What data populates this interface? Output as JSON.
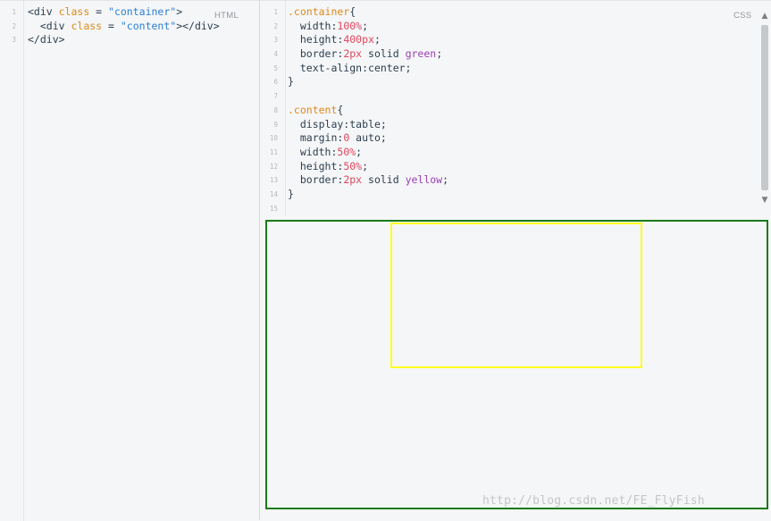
{
  "html_panel": {
    "label": "HTML",
    "lines": [
      {
        "n": "1",
        "tokens": [
          {
            "t": "<div ",
            "c": "tag"
          },
          {
            "t": "class",
            "c": "attr"
          },
          {
            "t": " = ",
            "c": "plain"
          },
          {
            "t": "\"container\"",
            "c": "str"
          },
          {
            "t": ">",
            "c": "tag"
          }
        ]
      },
      {
        "n": "2",
        "tokens": [
          {
            "t": "  <div ",
            "c": "tag"
          },
          {
            "t": "class",
            "c": "attr"
          },
          {
            "t": " = ",
            "c": "plain"
          },
          {
            "t": "\"content\"",
            "c": "str"
          },
          {
            "t": "></div>",
            "c": "tag"
          }
        ]
      },
      {
        "n": "3",
        "tokens": [
          {
            "t": "</div>",
            "c": "tag"
          }
        ]
      }
    ]
  },
  "css_panel": {
    "label": "CSS",
    "lines": [
      {
        "n": "1",
        "tokens": [
          {
            "t": ".container",
            "c": "sel"
          },
          {
            "t": "{",
            "c": "plain"
          }
        ]
      },
      {
        "n": "2",
        "tokens": [
          {
            "t": "  width:",
            "c": "prop"
          },
          {
            "t": "100%",
            "c": "num"
          },
          {
            "t": ";",
            "c": "plain"
          }
        ]
      },
      {
        "n": "3",
        "tokens": [
          {
            "t": "  height:",
            "c": "prop"
          },
          {
            "t": "400px",
            "c": "num"
          },
          {
            "t": ";",
            "c": "plain"
          }
        ]
      },
      {
        "n": "4",
        "tokens": [
          {
            "t": "  border:",
            "c": "prop"
          },
          {
            "t": "2px",
            "c": "num"
          },
          {
            "t": " solid ",
            "c": "plain"
          },
          {
            "t": "green",
            "c": "kw"
          },
          {
            "t": ";",
            "c": "plain"
          }
        ]
      },
      {
        "n": "5",
        "tokens": [
          {
            "t": "  text-align:",
            "c": "prop"
          },
          {
            "t": "center;",
            "c": "plain"
          }
        ]
      },
      {
        "n": "6",
        "tokens": [
          {
            "t": "}",
            "c": "plain"
          }
        ]
      },
      {
        "n": "7",
        "tokens": []
      },
      {
        "n": "8",
        "tokens": [
          {
            "t": ".content",
            "c": "sel"
          },
          {
            "t": "{",
            "c": "plain"
          }
        ]
      },
      {
        "n": "9",
        "tokens": [
          {
            "t": "  display:",
            "c": "prop"
          },
          {
            "t": "table;",
            "c": "plain"
          }
        ]
      },
      {
        "n": "10",
        "tokens": [
          {
            "t": "  margin:",
            "c": "prop"
          },
          {
            "t": "0",
            "c": "num"
          },
          {
            "t": " auto;",
            "c": "plain"
          }
        ]
      },
      {
        "n": "11",
        "tokens": [
          {
            "t": "  width:",
            "c": "prop"
          },
          {
            "t": "50%",
            "c": "num"
          },
          {
            "t": ";",
            "c": "plain"
          }
        ]
      },
      {
        "n": "12",
        "tokens": [
          {
            "t": "  height:",
            "c": "prop"
          },
          {
            "t": "50%",
            "c": "num"
          },
          {
            "t": ";",
            "c": "plain"
          }
        ]
      },
      {
        "n": "13",
        "tokens": [
          {
            "t": "  border:",
            "c": "prop"
          },
          {
            "t": "2px",
            "c": "num"
          },
          {
            "t": " solid ",
            "c": "plain"
          },
          {
            "t": "yellow",
            "c": "kw"
          },
          {
            "t": ";",
            "c": "plain"
          }
        ]
      },
      {
        "n": "14",
        "tokens": [
          {
            "t": "}",
            "c": "plain"
          }
        ]
      },
      {
        "n": "15",
        "tokens": []
      }
    ]
  },
  "preview": {
    "container_border_color": "#1a7a1a",
    "content_border_color": "#ffff1c"
  },
  "watermark": "http://blog.csdn.net/FE_FlyFish",
  "colors": {
    "background": "#f5f6f7",
    "selector": "#dd8a1b",
    "string": "#2a7fd4",
    "number": "#e0445d",
    "keyword": "#9b3fb5",
    "text": "#2c3e50"
  },
  "icons": {
    "scroll_up": "chevron-up-icon",
    "scroll_down": "chevron-down-icon"
  }
}
